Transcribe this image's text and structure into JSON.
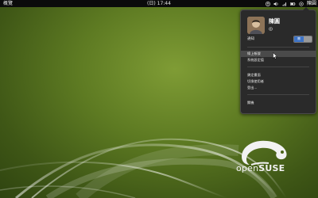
{
  "topbar": {
    "activities_label": "概覽",
    "clock": "(日) 17:44",
    "user_name": "陳圓"
  },
  "user_menu": {
    "display_name": "陳圓",
    "status": {
      "label": "",
      "dropdown": ""
    },
    "notifications": {
      "label": "通知",
      "toggle_on_label": "開"
    },
    "items_top": [
      "線上帳號",
      "系統設定值"
    ],
    "items_bottom": [
      "鎖定畫面",
      "切換使用者",
      "登出..."
    ],
    "power_item": "關機"
  },
  "desktop": {
    "logo_text_a": "open",
    "logo_text_b": "SUSE"
  },
  "colors": {
    "accent": "#3d73c6",
    "panel": "#0b0b0b",
    "menu_bg": "#2a2a2a",
    "wallpaper": "#5d7a22"
  }
}
